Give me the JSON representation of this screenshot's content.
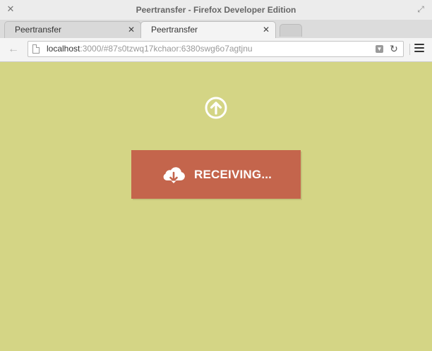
{
  "window": {
    "title": "Peertransfer - Firefox Developer Edition",
    "close_glyph": "✕",
    "maximize_glyph": "⤢"
  },
  "tabs": [
    {
      "label": "Peertransfer",
      "close_glyph": "✕",
      "active": false
    },
    {
      "label": "Peertransfer",
      "close_glyph": "✕",
      "active": true
    }
  ],
  "navbar": {
    "back_glyph": "←",
    "url_host": "localhost",
    "url_rest": ":3000/#87s0tzwq17kchaor:6380swg6o7agtjnu",
    "reload_glyph": "↻",
    "dropdown_glyph": "▼"
  },
  "page": {
    "background": "#d4d585",
    "upload_icon": "arrow-up-circle-icon",
    "status_button": {
      "label": "RECEIVING...",
      "icon": "cloud-download-icon",
      "color": "#c4654c"
    }
  }
}
